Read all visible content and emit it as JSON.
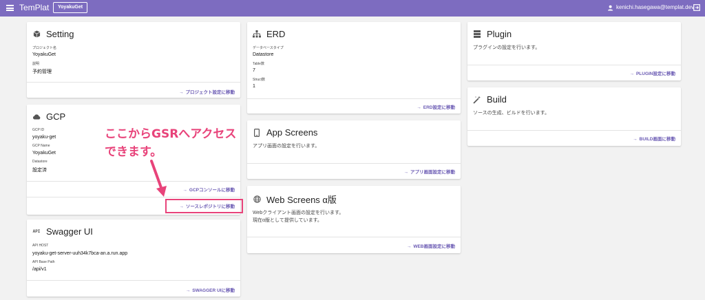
{
  "header": {
    "app_title": "TemPlat",
    "project": "YoyakuGet",
    "user_email": "kenichi.hasegawa@templat.dev",
    "bg_color": "#7d6cc0"
  },
  "cards": {
    "setting": {
      "title": "Setting",
      "icon": "cube-icon",
      "fields": [
        {
          "label": "プロジェクト名",
          "value": "YoyakuGet"
        },
        {
          "label": "説明",
          "value": "予約管理"
        }
      ],
      "action": "プロジェクト設定に移動"
    },
    "gcp": {
      "title": "GCP",
      "icon": "cloud-icon",
      "fields": [
        {
          "label": "GCP ID",
          "value": "yoyaku-get"
        },
        {
          "label": "GCP Name",
          "value": "YoyakuGet"
        },
        {
          "label": "Datastore",
          "value": "設定済"
        }
      ],
      "action_console": "GCPコンソールに移動",
      "action_repo": "ソースレポジトリに移動"
    },
    "swagger": {
      "title": "Swagger UI",
      "icon_text": "API",
      "fields": [
        {
          "label": "API HOST",
          "value": "yoyaku-get-server-uuh34k7bca-an.a.run.app"
        },
        {
          "label": "API Base Path",
          "value": "/api/v1"
        }
      ],
      "action": "SWAGGER UIに移動"
    },
    "erd": {
      "title": "ERD",
      "icon": "sitemap-icon",
      "fields": [
        {
          "label": "データベースタイプ",
          "value": "Datastore"
        },
        {
          "label": "Table数",
          "value": "7"
        },
        {
          "label": "Struct数",
          "value": "1"
        }
      ],
      "action": "ERD設定に移動"
    },
    "app_screens": {
      "title": "App Screens",
      "icon": "phone-icon",
      "desc": "アプリ画面の設定を行います。",
      "action": "アプリ画面設定に移動"
    },
    "web_screens": {
      "title": "Web Screens α版",
      "icon": "globe-icon",
      "desc1": "Webクライアント画面の設定を行います。",
      "desc2": "現在α版として提供しています。",
      "action": "WEB画面設定に移動"
    },
    "plugin": {
      "title": "Plugin",
      "icon": "storage-icon",
      "desc": "プラグインの設定を行います。",
      "action": "PLUGIN設定に移動"
    },
    "build": {
      "title": "Build",
      "icon": "magic-wand-icon",
      "desc": "ソースの生成、ビルドを行います。",
      "action": "BUILD画面に移動"
    }
  },
  "callout": {
    "line1": "ここからGSRへアクセス",
    "line2": "できます。",
    "color": "#e8437a"
  }
}
